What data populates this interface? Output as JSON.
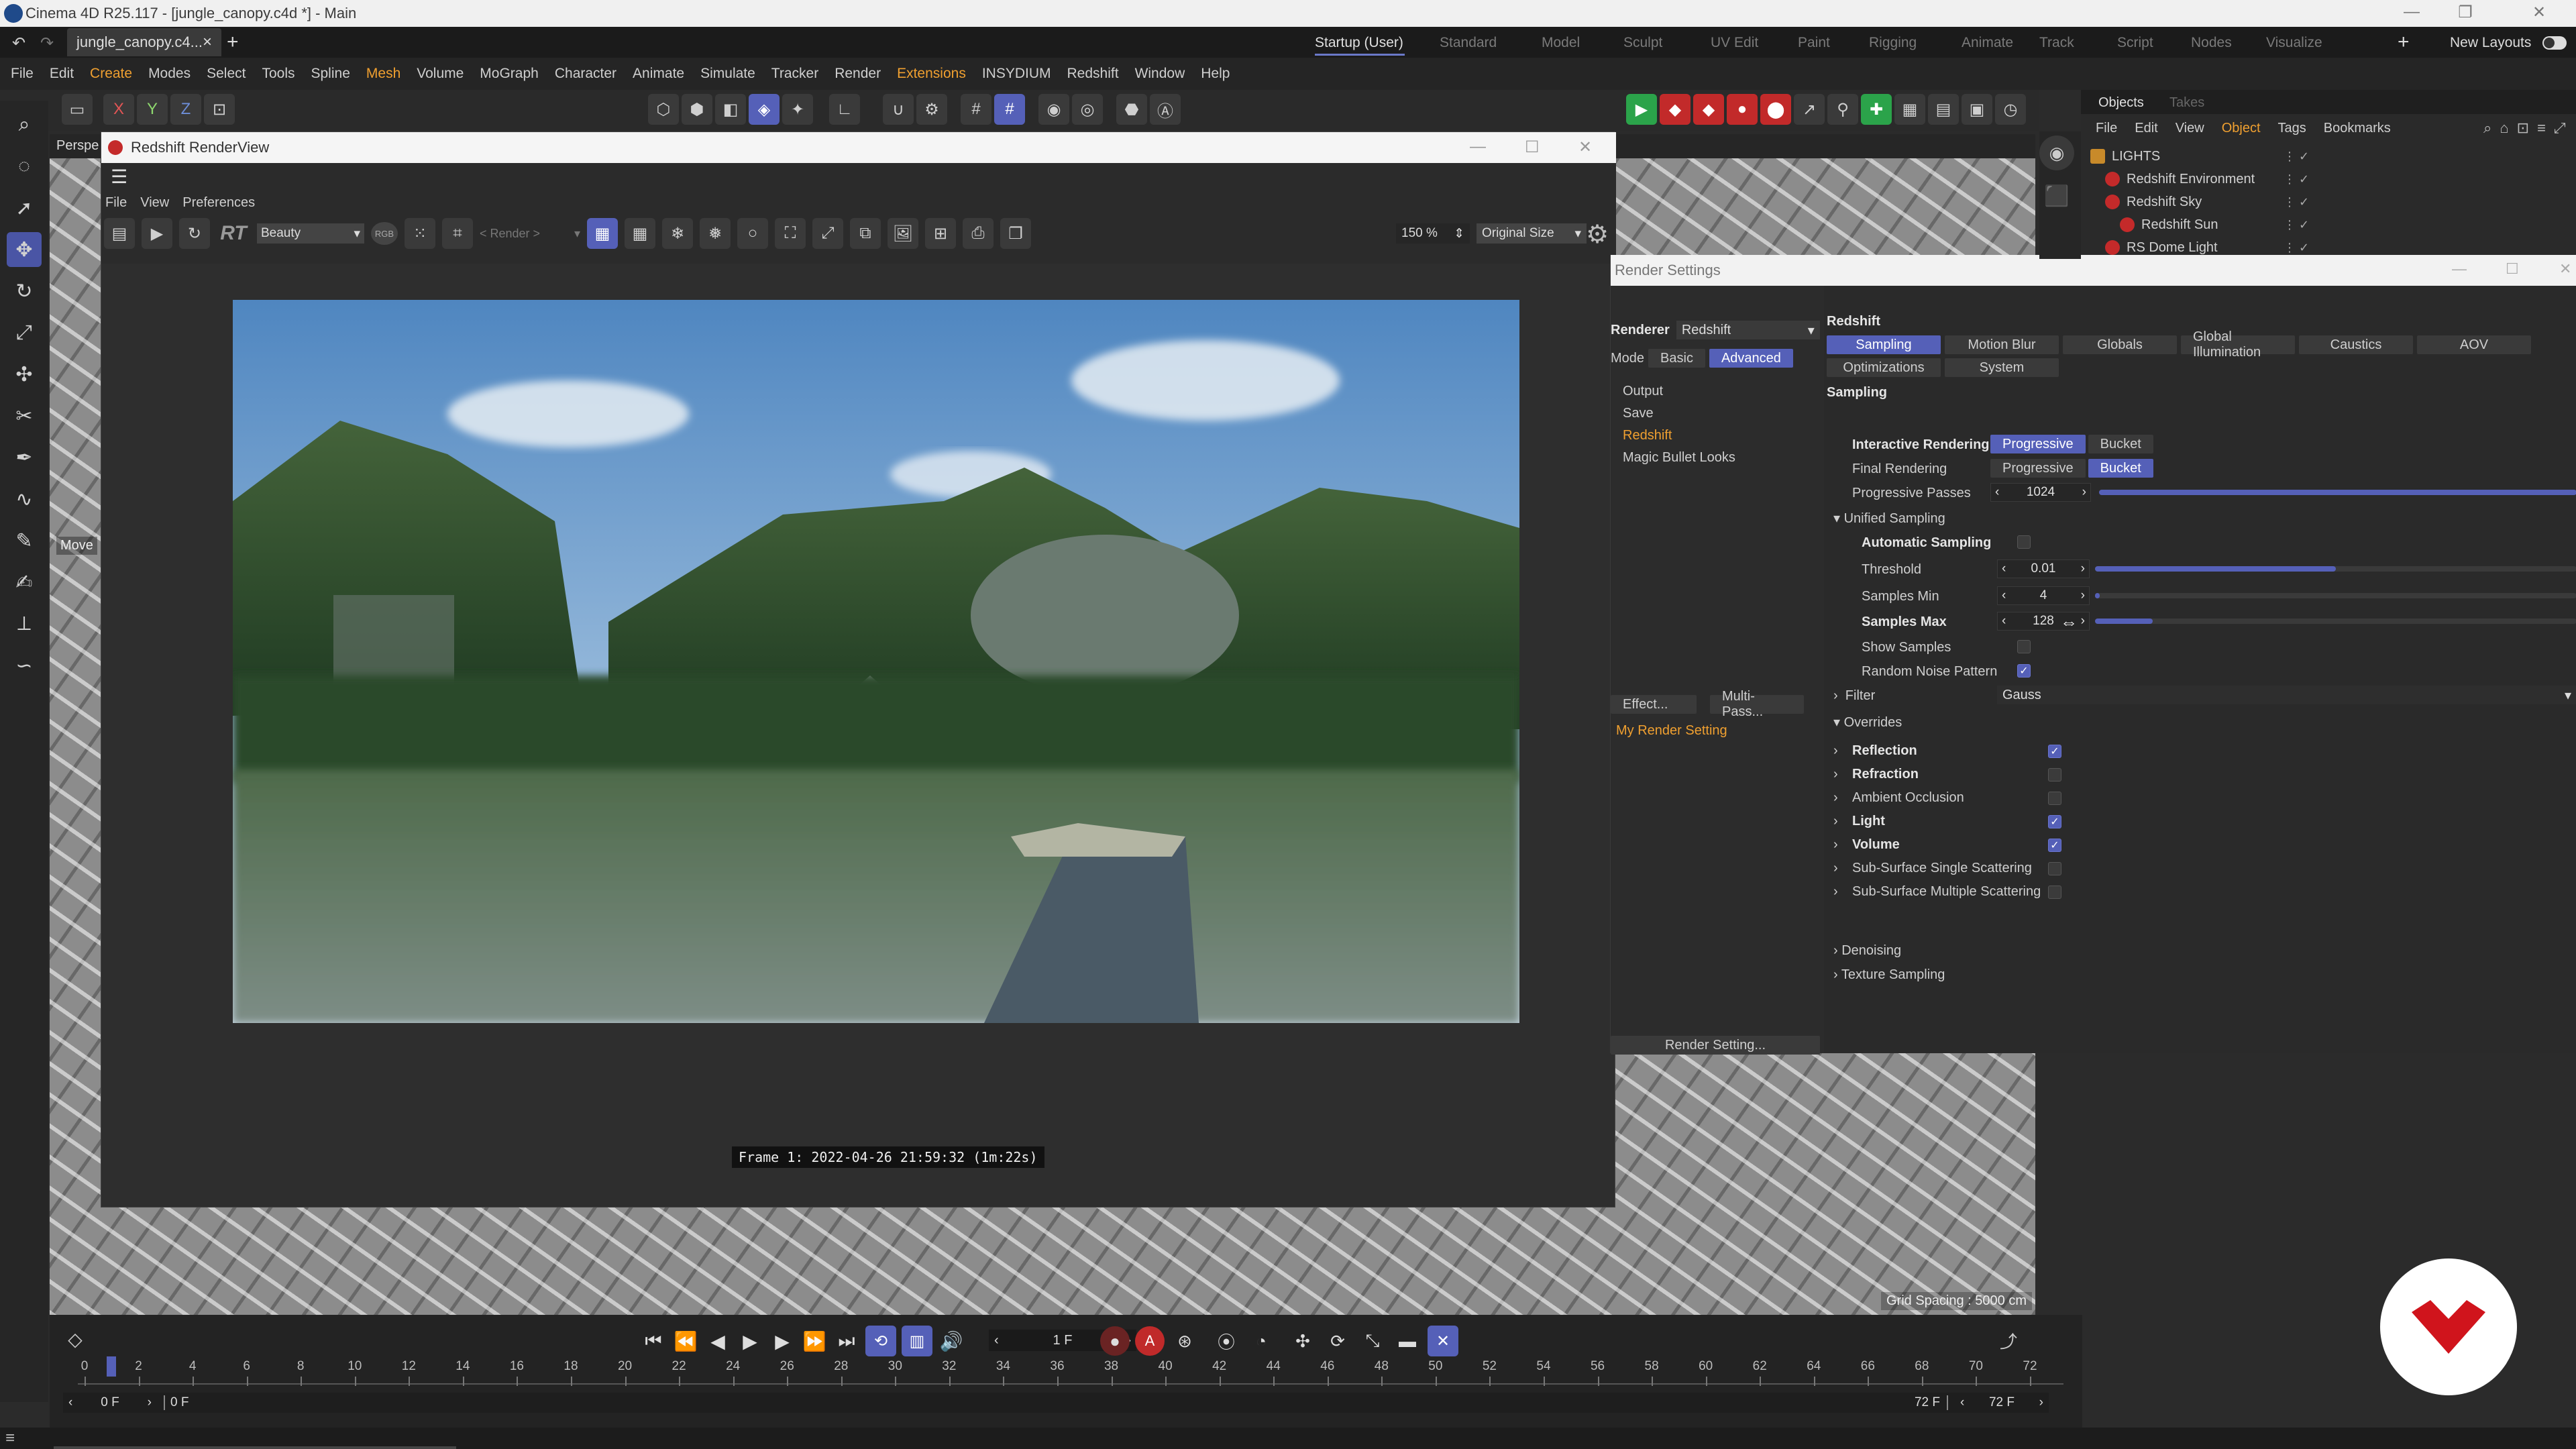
{
  "window": {
    "title": "Cinema 4D R25.117 - [jungle_canopy.c4d *] - Main"
  },
  "doc_tab": {
    "label": "jungle_canopy.c4...",
    "close": "×",
    "add": "+"
  },
  "layouts": {
    "items": [
      "Startup (User)",
      "Standard",
      "Model",
      "Sculpt",
      "UV Edit",
      "Paint",
      "Rigging",
      "Animate",
      "Track",
      "Script",
      "Nodes",
      "Visualize"
    ],
    "active": "Startup (User)",
    "plus": "+",
    "new_layouts": "New Layouts"
  },
  "menu": [
    "File",
    "Edit",
    "Create",
    "Modes",
    "Select",
    "Tools",
    "Spline",
    "Mesh",
    "Volume",
    "MoGraph",
    "Character",
    "Animate",
    "Simulate",
    "Tracker",
    "Render",
    "Extensions",
    "INSYDIUM",
    "Redshift",
    "Window",
    "Help"
  ],
  "toolbar": {
    "x": "X",
    "y": "Y",
    "z": "Z"
  },
  "viewport": {
    "label": "Perspe",
    "move_hint": "Move",
    "grid_spacing": "Grid Spacing : 5000 cm"
  },
  "renderview": {
    "title": "Redshift RenderView",
    "menu": [
      "File",
      "View",
      "Preferences"
    ],
    "rt": "RT",
    "aov": "Beauty",
    "rgb": "RGB",
    "render_dropdown": "< Render >",
    "zoom": "150 %",
    "size": "Original Size",
    "frame_info": "Frame  1:  2022-04-26  21:59:32  (1m:22s)"
  },
  "render_settings": {
    "title": "Render Settings",
    "renderer_label": "Renderer",
    "renderer_value": "Redshift",
    "mode_label": "Mode",
    "mode_basic": "Basic",
    "mode_advanced": "Advanced",
    "tree": [
      "Output",
      "Save",
      "Redshift",
      "Magic Bullet Looks"
    ],
    "effect_btn": "Effect...",
    "multipass_btn": "Multi-Pass...",
    "my_setting": "My Render Setting",
    "render_setting_btn": "Render Setting...",
    "section": "Redshift",
    "tabs_row1": [
      "Sampling",
      "Motion Blur",
      "Globals",
      "Global Illumination",
      "Caustics",
      "AOV"
    ],
    "tabs_row2": [
      "Optimizations",
      "System"
    ],
    "sampling_header": "Sampling",
    "interactive_label": "Interactive Rendering",
    "final_label": "Final Rendering",
    "progressive": "Progressive",
    "bucket": "Bucket",
    "passes_label": "Progressive Passes",
    "passes_value": "1024",
    "passes_fill": 1.0,
    "unified": "Unified Sampling",
    "auto_sampling": "Automatic Sampling",
    "threshold_label": "Threshold",
    "threshold_value": "0.01",
    "threshold_fill": 0.5,
    "smin_label": "Samples Min",
    "smin_value": "4",
    "smin_fill": 0.01,
    "smax_label": "Samples Max",
    "smax_value": "128",
    "smax_fill": 0.12,
    "show_samples": "Show Samples",
    "random_noise": "Random Noise Pattern",
    "filter_label": "Filter",
    "filter_value": "Gauss",
    "overrides": "Overrides",
    "override_items": [
      {
        "label": "Reflection",
        "bold": true,
        "checked": true
      },
      {
        "label": "Refraction",
        "bold": true,
        "checked": false
      },
      {
        "label": "Ambient Occlusion",
        "bold": false,
        "checked": false
      },
      {
        "label": "Light",
        "bold": true,
        "checked": true
      },
      {
        "label": "Volume",
        "bold": true,
        "checked": true
      },
      {
        "label": "Sub-Surface Single Scattering",
        "bold": false,
        "checked": false
      },
      {
        "label": "Sub-Surface Multiple Scattering",
        "bold": false,
        "checked": false
      }
    ],
    "denoising": "Denoising",
    "texture_sampling": "Texture Sampling"
  },
  "objects": {
    "tabs": [
      "Objects",
      "Takes"
    ],
    "menu": [
      "File",
      "Edit",
      "View",
      "Object",
      "Tags",
      "Bookmarks"
    ],
    "rows": [
      {
        "name": "LIGHTS",
        "indent": 0
      },
      {
        "name": "Redshift Environment",
        "indent": 1
      },
      {
        "name": "Redshift Sky",
        "indent": 1
      },
      {
        "name": "Redshift Sun",
        "indent": 2
      },
      {
        "name": "RS Dome Light",
        "indent": 1
      }
    ]
  },
  "timeline": {
    "frame_field": "1 F",
    "ticks": [
      0,
      2,
      4,
      6,
      8,
      10,
      12,
      14,
      16,
      18,
      20,
      22,
      24,
      26,
      28,
      30,
      32,
      34,
      36,
      38,
      40,
      42,
      44,
      46,
      48,
      50,
      52,
      54,
      56,
      58,
      60,
      62,
      64,
      66,
      68,
      70,
      72
    ],
    "start_field": "0 F",
    "start_field2": "0 F",
    "end_field": "72 F",
    "end_field2": "72 F",
    "current_frame": 1,
    "max_frame": 72
  },
  "colors": {
    "accent": "#5560b8",
    "brand_red": "#d0141c"
  }
}
